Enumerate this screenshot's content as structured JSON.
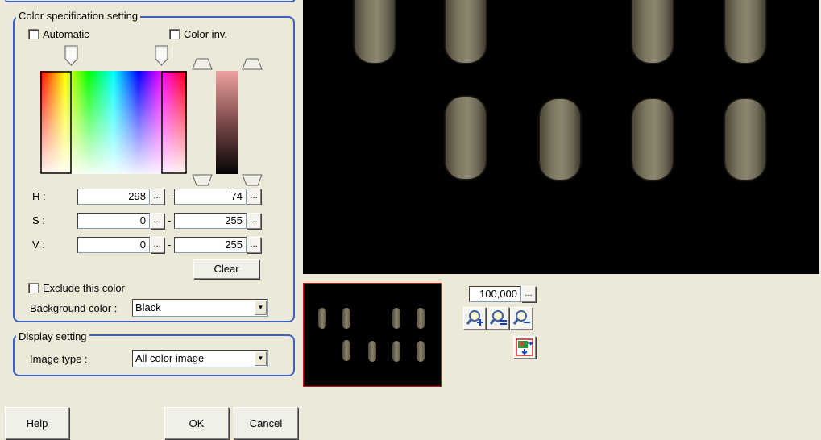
{
  "color_spec": {
    "legend": "Color specification setting",
    "automatic_label": "Automatic",
    "automatic_checked": false,
    "color_inv_label": "Color inv.",
    "color_inv_checked": false,
    "h": {
      "label": "H :",
      "min": "298",
      "max": "74"
    },
    "s": {
      "label": "S :",
      "min": "0",
      "max": "255"
    },
    "v": {
      "label": "V :",
      "min": "0",
      "max": "255"
    },
    "dots_label": "...",
    "range_sep": "-",
    "clear_label": "Clear",
    "exclude_label": "Exclude this color",
    "exclude_checked": false,
    "background_color_label": "Background color :",
    "background_color_value": "Black"
  },
  "display": {
    "legend": "Display setting",
    "image_type_label": "Image type :",
    "image_type_value": "All color image"
  },
  "zoom": {
    "value": "100,000",
    "dots_label": "..."
  },
  "tools": [
    "zoom-in-icon",
    "zoom-fit-icon",
    "zoom-out-icon",
    "export-image-icon"
  ],
  "buttons": {
    "help": "Help",
    "ok": "OK",
    "cancel": "Cancel"
  },
  "colors": {
    "group_border": "#3C5FC0",
    "background": "#ECE9D8",
    "thumbnail_border": "#D01010"
  }
}
